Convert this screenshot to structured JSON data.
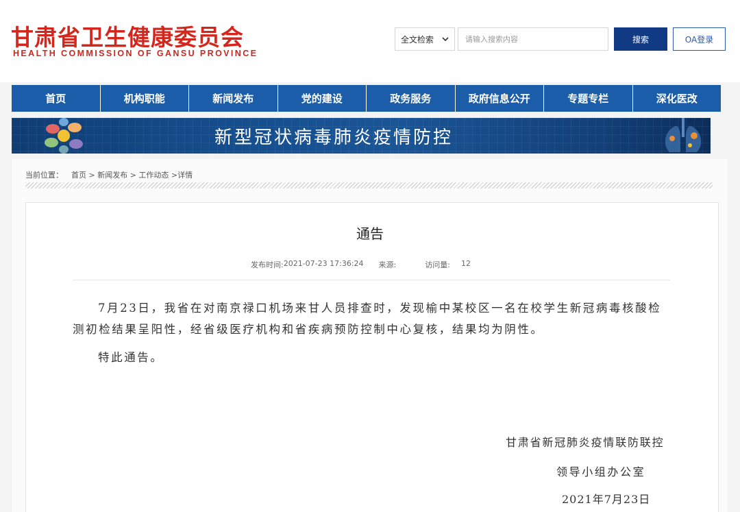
{
  "header": {
    "logo_cn": "甘肃省卫生健康委员会",
    "logo_en": "HEALTH COMMISSION OF GANSU PROVINCE",
    "search_scope": "全文检索",
    "search_placeholder": "请输入搜索内容",
    "search_button": "搜索",
    "oa_button": "OA登录"
  },
  "nav": {
    "items": [
      {
        "label": "首页"
      },
      {
        "label": "机构职能"
      },
      {
        "label": "新闻发布"
      },
      {
        "label": "党的建设"
      },
      {
        "label": "政务服务"
      },
      {
        "label": "政府信息公开"
      },
      {
        "label": "专题专栏"
      },
      {
        "label": "深化医改"
      }
    ]
  },
  "banner": {
    "text": "新型冠状病毒肺炎疫情防控"
  },
  "breadcrumb": {
    "label": "当前位置：",
    "path": "首页 > 新闻发布 > 工作动态 >详情"
  },
  "article": {
    "title": "通告",
    "publish_label": "发布时间:",
    "publish_time": "2021-07-23 17:36:24",
    "source_label": "来源:",
    "source_value": "",
    "views_label": "访问量:",
    "views_value": "12",
    "paragraph1": "7月23日，我省在对南京禄口机场来甘人员排查时，发现榆中某校区一名在校学生新冠病毒核酸检测初检结果呈阳性，经省级医疗机构和省疾病预防控制中心复核，结果均为阴性。",
    "paragraph2": "特此通告。",
    "signature_line1": "甘肃省新冠肺炎疫情联防联控",
    "signature_line2": "领导小组办公室",
    "signature_date": "2021年7月23日"
  }
}
